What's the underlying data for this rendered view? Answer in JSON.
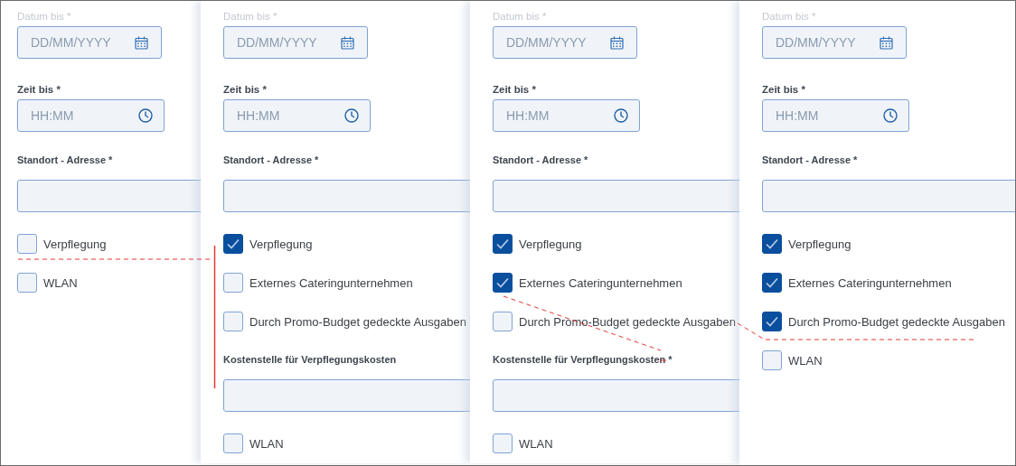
{
  "panels": [
    {
      "items": [
        {
          "kind": "date",
          "label": "Datum bis *",
          "placeholder": "DD/MM/YYYY"
        },
        {
          "kind": "time",
          "label": "Zeit bis *",
          "placeholder": "HH:MM"
        },
        {
          "kind": "text",
          "label": "Standort - Adresse *"
        },
        {
          "kind": "checkbox",
          "label": "Verpflegung",
          "checked": false
        },
        {
          "kind": "checkbox",
          "label": "WLAN",
          "checked": false
        }
      ]
    },
    {
      "items": [
        {
          "kind": "date",
          "label": "Datum bis *",
          "placeholder": "DD/MM/YYYY"
        },
        {
          "kind": "time",
          "label": "Zeit bis *",
          "placeholder": "HH:MM"
        },
        {
          "kind": "text",
          "label": "Standort - Adresse *"
        },
        {
          "kind": "checkbox",
          "label": "Verpflegung",
          "checked": true
        },
        {
          "kind": "checkbox",
          "label": "Externes Cateringunternehmen",
          "checked": false
        },
        {
          "kind": "checkbox",
          "label": "Durch Promo-Budget gedeckte Ausgaben",
          "checked": false
        },
        {
          "kind": "text",
          "label": "Kostenstelle für Verpflegungskosten"
        },
        {
          "kind": "checkbox",
          "label": "WLAN",
          "checked": false
        }
      ]
    },
    {
      "items": [
        {
          "kind": "date",
          "label": "Datum bis *",
          "placeholder": "DD/MM/YYYY"
        },
        {
          "kind": "time",
          "label": "Zeit bis *",
          "placeholder": "HH:MM"
        },
        {
          "kind": "text",
          "label": "Standort - Adresse *"
        },
        {
          "kind": "checkbox",
          "label": "Verpflegung",
          "checked": true
        },
        {
          "kind": "checkbox",
          "label": "Externes Cateringunternehmen",
          "checked": true
        },
        {
          "kind": "checkbox",
          "label": "Durch Promo-Budget gedeckte Ausgaben",
          "checked": false
        },
        {
          "kind": "text",
          "label": "Kostenstelle für Verpflegungskosten *"
        },
        {
          "kind": "checkbox",
          "label": "WLAN",
          "checked": false
        }
      ]
    },
    {
      "items": [
        {
          "kind": "date",
          "label": "Datum bis *",
          "placeholder": "DD/MM/YYYY"
        },
        {
          "kind": "time",
          "label": "Zeit bis *",
          "placeholder": "HH:MM"
        },
        {
          "kind": "text",
          "label": "Standort - Adresse *"
        },
        {
          "kind": "checkbox",
          "label": "Verpflegung",
          "checked": true
        },
        {
          "kind": "checkbox",
          "label": "Externes Cateringunternehmen",
          "checked": true
        },
        {
          "kind": "checkbox",
          "label": "Durch Promo-Budget gedeckte Ausgaben",
          "checked": true
        },
        {
          "kind": "checkbox",
          "label": "WLAN",
          "checked": false
        }
      ]
    }
  ]
}
